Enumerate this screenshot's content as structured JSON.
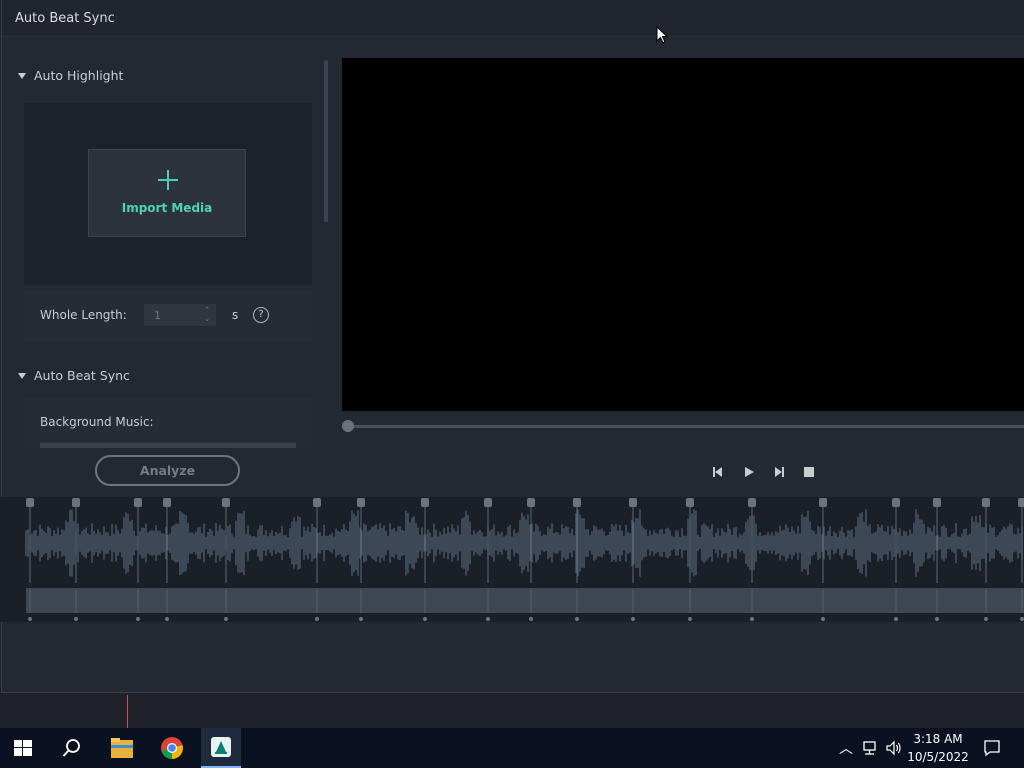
{
  "window": {
    "title": "Auto Beat Sync"
  },
  "auto_highlight": {
    "section_label": "Auto Highlight",
    "import_label": "Import Media",
    "whole_length_label": "Whole Length:",
    "whole_length_value": "1",
    "unit": "s",
    "help_icon": "?"
  },
  "auto_beat_sync": {
    "section_label": "Auto Beat Sync",
    "background_music_label": "Background Music:"
  },
  "analyze_button": "Analyze",
  "player": {
    "controls": [
      "prev-frame-icon",
      "play-icon",
      "next-frame-icon",
      "stop-icon"
    ]
  },
  "taskbar": {
    "time": "3:18 AM",
    "date": "10/5/2022",
    "icons": [
      "windows-start-icon",
      "search-icon",
      "file-explorer-icon",
      "chrome-icon",
      "filmora-icon"
    ]
  },
  "colors": {
    "accent": "#4fd1b8",
    "background": "#232933"
  }
}
